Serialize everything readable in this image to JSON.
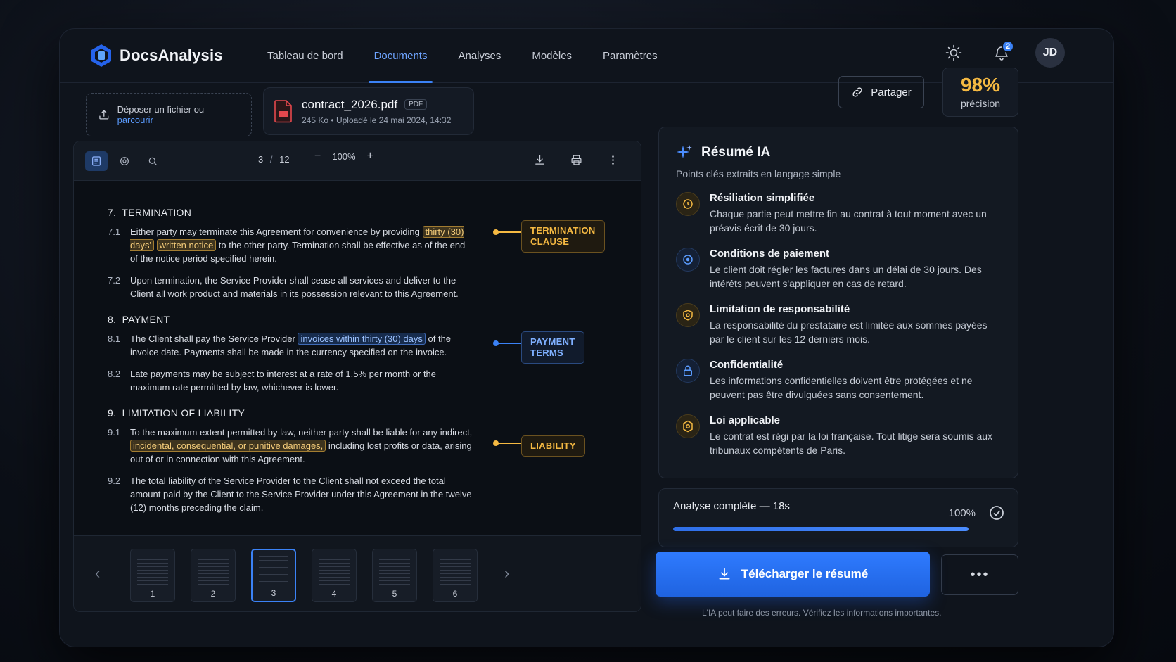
{
  "app": {
    "name": "DocsAnalysis"
  },
  "nav": [
    {
      "label": "Tableau de bord"
    },
    {
      "label": "Documents",
      "active": true
    },
    {
      "label": "Analyses"
    },
    {
      "label": "Modèles"
    },
    {
      "label": "Paramètres"
    }
  ],
  "header": {
    "notifications_count": "2",
    "user_initials": "JD",
    "theme_icon": "sun-icon",
    "bell_icon": "bell-icon"
  },
  "upload": {
    "text": "Déposer un fichier ou",
    "link": "parcourir"
  },
  "file": {
    "name": "contract_2026.pdf",
    "type": "PDF",
    "size": "245 Ko",
    "uploaded": "Uploadé le 24 mai 2024, 14:32"
  },
  "share": {
    "label": "Partager"
  },
  "precision": {
    "value": "98%",
    "label": "précision"
  },
  "viewer": {
    "page_current": "3",
    "page_total": "12",
    "page_sep": "/",
    "zoom": "100%",
    "zoom_minus": "−",
    "zoom_plus": "+"
  },
  "document": {
    "sections": [
      {
        "num": "7.",
        "title": "TERMINATION"
      },
      {
        "num": "8.",
        "title": "PAYMENT"
      },
      {
        "num": "9.",
        "title": "LIMITATION OF LIABILITY"
      }
    ],
    "c71": {
      "num": "7.1",
      "a": "Either party may terminate this Agreement for convenience by providing",
      "hl1": "thirty (30) days'",
      "hl2": "written notice",
      "b": "to the other party. Termination shall be effective as of the end of the notice period specified herein."
    },
    "c72": {
      "num": "7.2",
      "text": "Upon termination, the Service Provider shall cease all services and deliver to the Client all work product and materials in its possession relevant to this Agreement."
    },
    "c81": {
      "num": "8.1",
      "a": "The Client shall pay the Service Provider",
      "hl": "invoices within thirty (30) days",
      "b": "of the invoice date. Payments shall be made in the currency specified on the invoice."
    },
    "c82": {
      "num": "8.2",
      "text": "Late payments may be subject to interest at a rate of 1.5% per month or the maximum rate permitted by law, whichever is lower."
    },
    "c91": {
      "num": "9.1",
      "a": "To the maximum extent permitted by law, neither party shall be liable for any indirect,",
      "hl": "incidental, consequential, or punitive damages,",
      "b": "including lost profits or data, arising out of or in connection with this Agreement."
    },
    "c92": {
      "num": "9.2",
      "text": "The total liability of the Service Provider to the Client shall not exceed the total amount paid by the Client to the Service Provider under this Agreement in the twelve (12) months preceding the claim."
    },
    "tags": {
      "termination_1": "TERMINATION",
      "termination_2": "CLAUSE",
      "payment_1": "PAYMENT",
      "payment_2": "TERMS",
      "liability": "LIABILITY"
    }
  },
  "thumbnails": [
    "1",
    "2",
    "3",
    "4",
    "5",
    "6"
  ],
  "summary": {
    "title": "Résumé IA",
    "subtitle": "Points clés extraits en langage simple",
    "points": [
      {
        "title": "Résiliation simplifiée",
        "desc": "Chaque partie peut mettre fin au contrat à tout moment avec un préavis écrit de 30 jours.",
        "icon": "clock-icon",
        "tone": "amber"
      },
      {
        "title": "Conditions de paiement",
        "desc": "Le client doit régler les factures dans un délai de 30 jours. Des intérêts peuvent s'appliquer en cas de retard.",
        "icon": "clock-icon",
        "tone": "blue"
      },
      {
        "title": "Limitation de responsabilité",
        "desc": "La responsabilité du prestataire est limitée aux sommes payées par le client sur les 12 derniers mois.",
        "icon": "shield-icon",
        "tone": "amber"
      },
      {
        "title": "Confidentialité",
        "desc": "Les informations confidentielles doivent être protégées et ne peuvent pas être divulguées sans consentement.",
        "icon": "lock-icon",
        "tone": "blue"
      },
      {
        "title": "Loi applicable",
        "desc": "Le contrat est régi par la loi française. Tout litige sera soumis aux tribunaux compétents de Paris.",
        "icon": "badge-icon",
        "tone": "amber"
      }
    ]
  },
  "progress": {
    "label": "Analyse complète — 18s",
    "percent": "100%",
    "fraction": 1.0
  },
  "download": {
    "label": "Télécharger le résumé"
  },
  "more": {
    "label": "•••"
  },
  "disclaimer": "L'IA peut faire des erreurs. Vérifiez les informations importantes.",
  "colors": {
    "accent": "#3b82f6",
    "amber": "#f5b942",
    "background": "#0f141c"
  }
}
